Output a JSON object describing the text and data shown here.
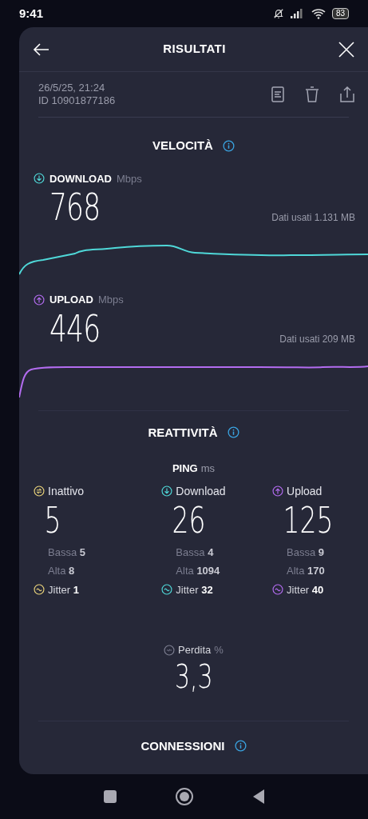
{
  "status_bar": {
    "time": "9:41",
    "battery": "83"
  },
  "header": {
    "title": "RISULTATI"
  },
  "meta": {
    "date": "26/5/25, 21:24",
    "id": "ID 10901877186"
  },
  "speed": {
    "title": "VELOCITÀ",
    "tests": [
      {
        "kind": "download",
        "label": "DOWNLOAD",
        "unit": "Mbps",
        "value": "768",
        "data_used": "Dati usati 1.131 MB"
      },
      {
        "kind": "upload",
        "label": "UPLOAD",
        "unit": "Mbps",
        "value": "446",
        "data_used": "Dati usati 209 MB"
      }
    ]
  },
  "responsiveness": {
    "title": "REATTIVITÀ",
    "ping_label": "PING",
    "ping_unit": "ms",
    "columns": [
      {
        "kind": "idle",
        "label": "Inattivo",
        "value": "5",
        "low_label": "Bassa",
        "low": "5",
        "high_label": "Alta",
        "high": "8",
        "jitter_label": "Jitter",
        "jitter": "1"
      },
      {
        "kind": "download",
        "label": "Download",
        "value": "26",
        "low_label": "Bassa",
        "low": "4",
        "high_label": "Alta",
        "high": "1094",
        "jitter_label": "Jitter",
        "jitter": "32"
      },
      {
        "kind": "upload",
        "label": "Upload",
        "value": "125",
        "low_label": "Bassa",
        "low": "9",
        "high_label": "Alta",
        "high": "170",
        "jitter_label": "Jitter",
        "jitter": "40"
      }
    ],
    "loss": {
      "label": "Perdita",
      "unit": "%",
      "value": "3,3"
    }
  },
  "connections": {
    "title": "CONNESSIONI"
  }
}
